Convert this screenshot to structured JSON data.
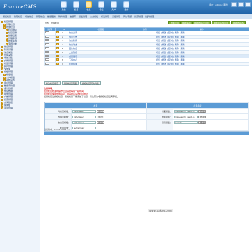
{
  "header": {
    "logo": "EmpireCMS",
    "icons": [
      {
        "label": "系统",
        "icon": "system-icon"
      },
      {
        "label": "栏目",
        "icon": "column-icon"
      },
      {
        "label": "信息",
        "icon": "info-icon"
      },
      {
        "label": "模板",
        "icon": "template-icon"
      },
      {
        "label": "用户",
        "icon": "user-icon"
      },
      {
        "label": "插件",
        "icon": "plugin-icon"
      }
    ],
    "user_text": "用户：admin  [退出]"
  },
  "menubar": [
    "增加栏目",
    "管理栏目",
    "增加信息",
    "管理信息",
    "数据更新",
    "附件管理",
    "数据库",
    "模板管理",
    "公共模板",
    "标签管理",
    "采集管理",
    "网站专题",
    "投票管理",
    "插件管理"
  ],
  "sidebar": {
    "items": [
      "栏目管理",
      "管理栏目",
      "增加栏目",
      "栏目排序",
      "栏目目录",
      "批量设置",
      "管理专题",
      "增加专题",
      "专题分类",
      "信息管理",
      "附件管理",
      "信息采集",
      "管理采集",
      "增加采集",
      "文件管理",
      "标签管理",
      "碎片管理",
      "文件夹",
      "模板管理",
      "模板组",
      "公共模板",
      "系统设置",
      "用户管理",
      "数据库管理",
      "备份数据",
      "恢复数据",
      "插件管理",
      "广告管理",
      "投票管理",
      "友情链接",
      "留言板",
      "评论管理"
    ]
  },
  "main": {
    "breadcrumb": "位置：管理栏目",
    "toolbar": [
      "增加栏目",
      "刷新首页",
      "刷新所有栏目页",
      "刷新所有信息页",
      "刷新所有JS"
    ],
    "table": {
      "headers": [
        "顺序",
        "",
        "ID",
        "栏目名",
        "访问",
        "操作"
      ],
      "rows": [
        {
          "id": "1",
          "name": "信息资讯",
          "ops": "增加 | 修改 | 复制 | 删除 | 刷新"
        },
        {
          "id": "2",
          "name": "信息公告",
          "ops": "增加 | 修改 | 复制 | 删除 | 刷新"
        },
        {
          "id": "3",
          "name": "信息新闻",
          "ops": "增加 | 修改 | 复制 | 删除 | 刷新"
        },
        {
          "id": "4",
          "name": "信息动态",
          "ops": "增加 | 修改 | 复制 | 删除 | 刷新"
        },
        {
          "id": "5",
          "name": "图片信息",
          "ops": "增加 | 修改 | 复制 | 删除 | 刷新"
        },
        {
          "id": "6",
          "name": "文章列表",
          "ops": "增加 | 修改 | 复制 | 删除 | 刷新"
        },
        {
          "id": "7",
          "name": "成果展示",
          "ops": "增加 | 修改 | 复制 | 删除 | 刷新"
        },
        {
          "id": "8",
          "name": "下载中心",
          "ops": "增加 | 修改 | 复制 | 删除 | 刷新"
        },
        {
          "id": "9",
          "name": "在线留言",
          "ops": "增加 | 修改 | 复制 | 删除 | 刷新"
        }
      ]
    },
    "actions": [
      "修改栏目顺序",
      "刷新栏目页面",
      "终极栏目转为列表"
    ],
    "notes": {
      "title": "注意事项：",
      "l1": "如果栏目较多时操作栏目需要等待一段时间。",
      "l2": "如果栏目使用外部链接，则需要先设置栏目地址。",
      "l3": "如果栏目是终极栏目，终极栏目不能添加子栏目，请先转为非终极栏目后再添加。"
    },
    "info": {
      "left": [
        {
          "label": "列表页模板：",
          "value": "/d/js/class/",
          "btn": "[修改]"
        },
        {
          "label": "内容页模板：",
          "value": "/d/js/class/",
          "btn": "[修改]"
        },
        {
          "label": "信息页模板：",
          "value": "/d/js/class/",
          "btn": "[修改]"
        },
        {
          "label": "栏目目录：",
          "value": "/e/member/",
          "btn": ""
        }
      ],
      "right": [
        {
          "label": "封面模板：",
          "value": "/d/js/search_news1.js",
          "btn": "[修改]"
        },
        {
          "label": "搜索模板：",
          "value": "/d/js/search_news1.js",
          "btn": "[修改]"
        },
        {
          "label": "投稿模板：",
          "value": "search",
          "btn": "[修改]"
        }
      ],
      "hdr_l": "栏目",
      "hdr_r": "栏目模板"
    },
    "footer": "当前版本：EmpireCMS 7.5"
  },
  "watermark": "www.pakeg.com"
}
